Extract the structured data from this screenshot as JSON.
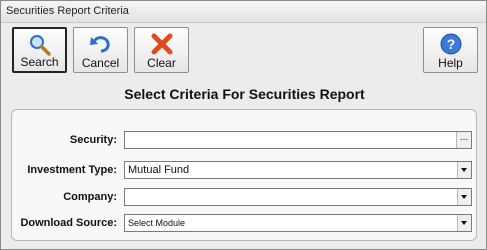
{
  "window": {
    "title": "Securities Report Criteria"
  },
  "toolbar": {
    "search_label": "Search",
    "cancel_label": "Cancel",
    "clear_label": "Clear",
    "help_label": "Help"
  },
  "heading": "Select Criteria For Securities Report",
  "form": {
    "security": {
      "label": "Security:",
      "value": "",
      "browse_label": "..."
    },
    "investment_type": {
      "label": "Investment Type:",
      "value": "Mutual Fund"
    },
    "company": {
      "label": "Company:",
      "value": ""
    },
    "download_source": {
      "label": "Download Source:",
      "value": "Select Module"
    }
  },
  "icons": {
    "search": "magnifier-icon",
    "cancel": "undo-arrow-icon",
    "clear": "red-x-icon",
    "help": "question-mark-icon"
  },
  "colors": {
    "accent_blue": "#2a6fd0",
    "clear_red": "#e04a1e",
    "heading": "#111111"
  }
}
